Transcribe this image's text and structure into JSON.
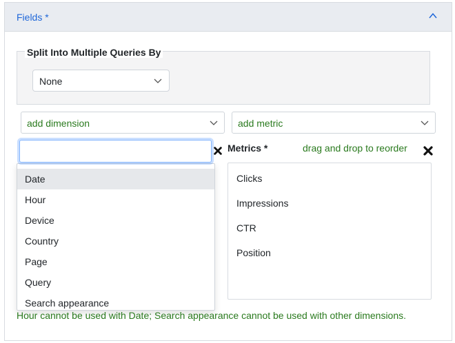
{
  "panel": {
    "title": "Fields *"
  },
  "split": {
    "legend": "Split Into Multiple Queries By",
    "selected": "None"
  },
  "dimension_select": {
    "label": "add dimension",
    "search_value": ""
  },
  "metric_select": {
    "label": "add metric"
  },
  "dimension_options": [
    "Date",
    "Hour",
    "Device",
    "Country",
    "Page",
    "Query",
    "Search appearance"
  ],
  "metrics": {
    "heading": "Metrics *",
    "hint": "drag and drop to reorder",
    "items": [
      "Clicks",
      "Impressions",
      "CTR",
      "Position"
    ]
  },
  "warning": "Hour cannot be used with Date; Search appearance cannot be used with other dimensions.",
  "colors": {
    "link_blue": "#1f67d9",
    "hint_green": "#2a7a1e",
    "header_bg": "#e9ecf1"
  },
  "icons": {
    "collapse": "chevron-up-icon",
    "dropdown": "chevron-down-icon",
    "clear": "x-icon"
  }
}
